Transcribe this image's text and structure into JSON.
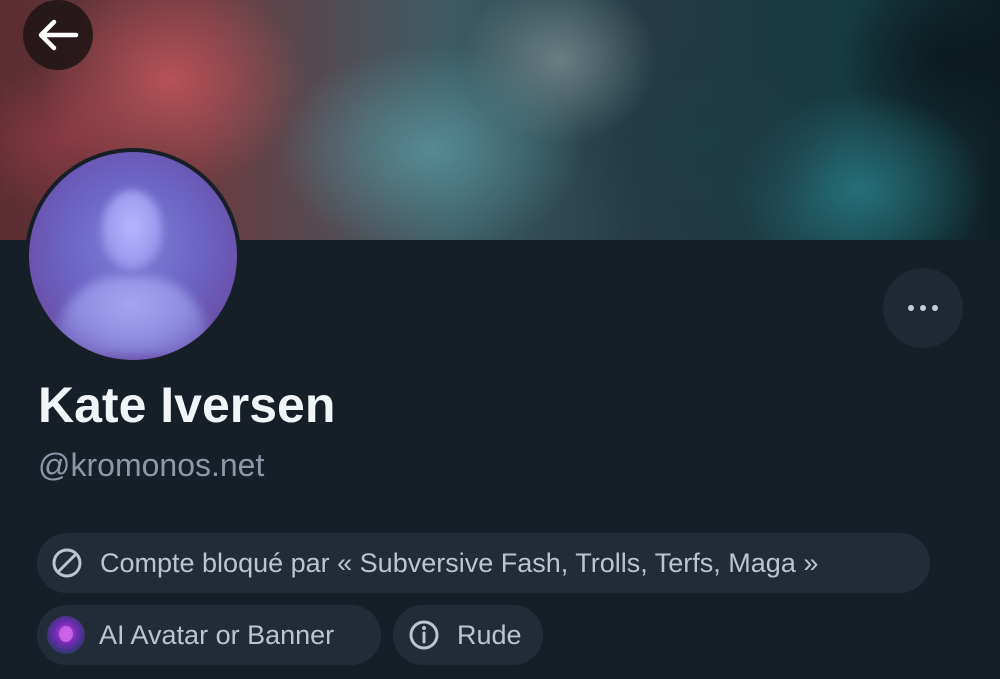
{
  "profile": {
    "display_name": "Kate Iversen",
    "handle": "@kromonos.net"
  },
  "labels": {
    "blocked_list": "Compte bloqué par « Subversive Fash, Trolls, Terfs, Maga »",
    "ai_avatar": "AI Avatar or Banner",
    "rude": "Rude"
  },
  "icons": {
    "back": "arrow-left-icon",
    "more": "ellipsis-icon",
    "blocked": "block-icon",
    "info": "info-icon"
  },
  "colors": {
    "background": "#161e27",
    "pill_background": "#222c38",
    "name_text": "#f2f5f8",
    "handle_text": "#8a98a8",
    "pill_text": "#b9c5d2"
  }
}
